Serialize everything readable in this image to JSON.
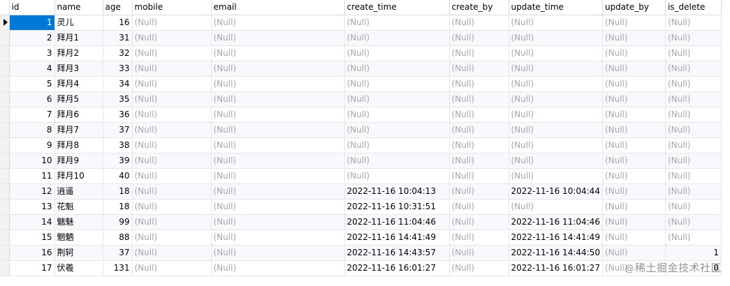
{
  "columns": [
    "id",
    "name",
    "age",
    "mobile",
    "email",
    "create_time",
    "create_by",
    "update_time",
    "update_by",
    "is_delete"
  ],
  "null_text": "(Null)",
  "watermark": {
    "at": "@",
    "text": "稀土掘金技术社区"
  },
  "rows": [
    {
      "id": "1",
      "name": "灵儿",
      "age": "16",
      "mobile": null,
      "email": null,
      "create_time": null,
      "create_by": null,
      "update_time": null,
      "update_by": null,
      "is_delete": null
    },
    {
      "id": "2",
      "name": "拜月1",
      "age": "31",
      "mobile": null,
      "email": null,
      "create_time": null,
      "create_by": null,
      "update_time": null,
      "update_by": null,
      "is_delete": null
    },
    {
      "id": "3",
      "name": "拜月2",
      "age": "32",
      "mobile": null,
      "email": null,
      "create_time": null,
      "create_by": null,
      "update_time": null,
      "update_by": null,
      "is_delete": null
    },
    {
      "id": "4",
      "name": "拜月3",
      "age": "33",
      "mobile": null,
      "email": null,
      "create_time": null,
      "create_by": null,
      "update_time": null,
      "update_by": null,
      "is_delete": null
    },
    {
      "id": "5",
      "name": "拜月4",
      "age": "34",
      "mobile": null,
      "email": null,
      "create_time": null,
      "create_by": null,
      "update_time": null,
      "update_by": null,
      "is_delete": null
    },
    {
      "id": "6",
      "name": "拜月5",
      "age": "35",
      "mobile": null,
      "email": null,
      "create_time": null,
      "create_by": null,
      "update_time": null,
      "update_by": null,
      "is_delete": null
    },
    {
      "id": "7",
      "name": "拜月6",
      "age": "36",
      "mobile": null,
      "email": null,
      "create_time": null,
      "create_by": null,
      "update_time": null,
      "update_by": null,
      "is_delete": null
    },
    {
      "id": "8",
      "name": "拜月7",
      "age": "37",
      "mobile": null,
      "email": null,
      "create_time": null,
      "create_by": null,
      "update_time": null,
      "update_by": null,
      "is_delete": null
    },
    {
      "id": "9",
      "name": "拜月8",
      "age": "38",
      "mobile": null,
      "email": null,
      "create_time": null,
      "create_by": null,
      "update_time": null,
      "update_by": null,
      "is_delete": null
    },
    {
      "id": "10",
      "name": "拜月9",
      "age": "39",
      "mobile": null,
      "email": null,
      "create_time": null,
      "create_by": null,
      "update_time": null,
      "update_by": null,
      "is_delete": null
    },
    {
      "id": "11",
      "name": "拜月10",
      "age": "40",
      "mobile": null,
      "email": null,
      "create_time": null,
      "create_by": null,
      "update_time": null,
      "update_by": null,
      "is_delete": null
    },
    {
      "id": "12",
      "name": "逍遥",
      "age": "18",
      "mobile": null,
      "email": null,
      "create_time": "2022-11-16 10:04:13",
      "create_by": null,
      "update_time": "2022-11-16 10:04:44",
      "update_by": null,
      "is_delete": null
    },
    {
      "id": "13",
      "name": "花魁",
      "age": "18",
      "mobile": null,
      "email": null,
      "create_time": "2022-11-16 10:31:51",
      "create_by": null,
      "update_time": null,
      "update_by": null,
      "is_delete": null
    },
    {
      "id": "14",
      "name": "魑魅",
      "age": "99",
      "mobile": null,
      "email": null,
      "create_time": "2022-11-16 11:04:46",
      "create_by": null,
      "update_time": "2022-11-16 11:04:46",
      "update_by": null,
      "is_delete": null
    },
    {
      "id": "15",
      "name": "魍魉",
      "age": "88",
      "mobile": null,
      "email": null,
      "create_time": "2022-11-16 14:41:49",
      "create_by": null,
      "update_time": "2022-11-16 14:41:49",
      "update_by": null,
      "is_delete": null
    },
    {
      "id": "16",
      "name": "荆轲",
      "age": "37",
      "mobile": null,
      "email": null,
      "create_time": "2022-11-16 14:43:57",
      "create_by": null,
      "update_time": "2022-11-16 14:44:50",
      "update_by": null,
      "is_delete": "1"
    },
    {
      "id": "17",
      "name": "伏羲",
      "age": "131",
      "mobile": null,
      "email": null,
      "create_time": "2022-11-16 16:01:27",
      "create_by": null,
      "update_time": "2022-11-16 16:01:27",
      "update_by": null,
      "is_delete": "0"
    }
  ]
}
